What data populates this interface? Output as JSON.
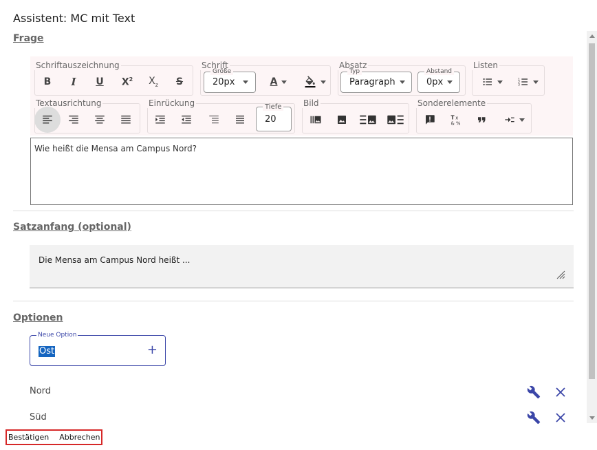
{
  "dialog": {
    "title": "Assistent: MC mit Text"
  },
  "frage": {
    "heading": "Frage",
    "toolbar": {
      "groups": {
        "schriftauszeichnung": "Schriftauszeichnung",
        "schrift": "Schrift",
        "absatz": "Absatz",
        "listen": "Listen",
        "textausrichtung": "Textausrichtung",
        "einrueckung": "Einrückung",
        "bild": "Bild",
        "sonderelemente": "Sonderelemente"
      },
      "groesse": {
        "label": "Größe",
        "value": "20px"
      },
      "typ": {
        "label": "Typ",
        "value": "Paragraph"
      },
      "abstand": {
        "label": "Abstand",
        "value": "0px"
      },
      "tiefe": {
        "label": "Tiefe",
        "value": "20"
      }
    },
    "text": "Wie heißt die Mensa am Campus Nord?"
  },
  "satzanfang": {
    "heading": "Satzanfang (optional)",
    "text": "Die Mensa am Campus Nord heißt ..."
  },
  "optionen": {
    "heading": "Optionen",
    "new_option": {
      "label": "Neue Option",
      "value": "Ost"
    },
    "items": [
      {
        "label": "Nord"
      },
      {
        "label": "Süd"
      }
    ]
  },
  "actions": {
    "confirm": "Bestätigen",
    "cancel": "Abbrechen"
  },
  "colors": {
    "accent": "#3b46a8",
    "toolbar_bg": "#fdf5f6",
    "highlight": "#d62828"
  }
}
